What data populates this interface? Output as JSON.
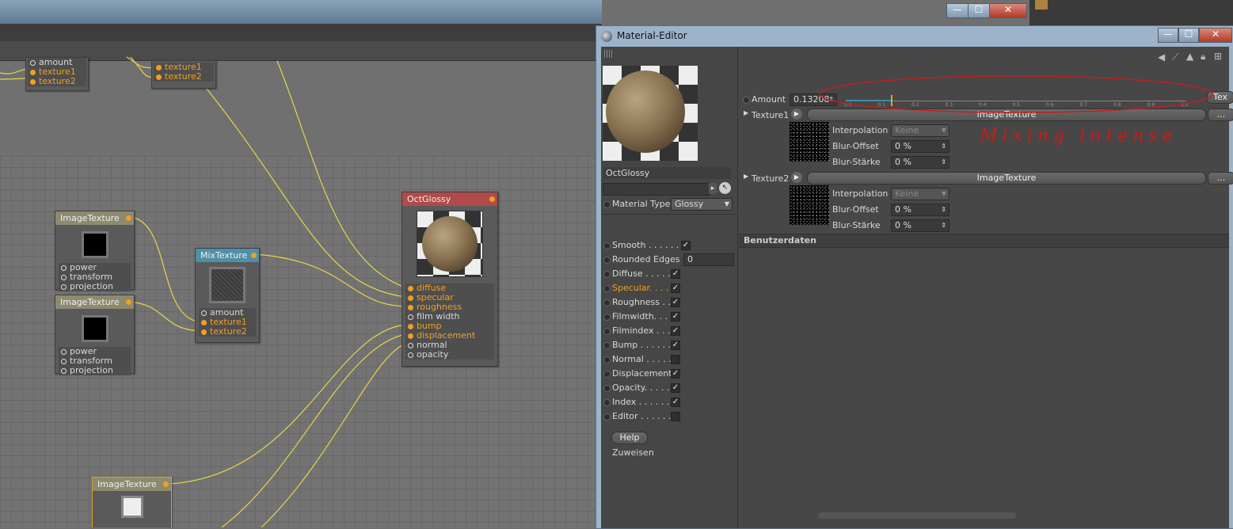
{
  "window": {
    "title": "Material-Editor",
    "min": "—",
    "max": "☐",
    "close": "✕"
  },
  "parent_window_buttons": {
    "min": "—",
    "max": "☐",
    "close": "✕"
  },
  "nodes": {
    "top_left": {
      "ports": [
        "amount",
        "texture1",
        "texture2"
      ]
    },
    "top_mid": {
      "ports": [
        "texture1",
        "texture2"
      ]
    },
    "img1": {
      "title": "ImageTexture",
      "ports": [
        "power",
        "transform",
        "projection"
      ]
    },
    "img2": {
      "title": "ImageTexture",
      "ports": [
        "power",
        "transform",
        "projection"
      ]
    },
    "mix": {
      "title": "MixTexture",
      "ports": [
        "amount",
        "texture1",
        "texture2"
      ]
    },
    "gloss": {
      "title": "OctGlossy",
      "ports": [
        "diffuse",
        "specular",
        "roughness",
        "film width",
        "bump",
        "displacement",
        "normal",
        "opacity"
      ]
    },
    "img3": {
      "title": "ImageTexture"
    }
  },
  "editor": {
    "material_name": "OctGlossy",
    "material_type_label": "Material Type",
    "material_type_value": "Glossy",
    "channels": [
      {
        "label": "Smooth . . . . . .",
        "checked": true
      },
      {
        "label": "Rounded Edges",
        "value": "0"
      },
      {
        "label": "Diffuse . . . . .",
        "checked": true
      },
      {
        "label": "Specular. . . .",
        "checked": true
      },
      {
        "label": "Roughness . .",
        "checked": true
      },
      {
        "label": "Filmwidth. . .",
        "checked": true
      },
      {
        "label": "Filmindex . . .",
        "checked": true
      },
      {
        "label": "Bump . . . . . .",
        "checked": true
      },
      {
        "label": "Normal . . . . .",
        "checked": false
      },
      {
        "label": "Displacement",
        "checked": true
      },
      {
        "label": "Opacity. . . . .",
        "checked": true
      },
      {
        "label": "Index . . . . . .",
        "checked": true
      },
      {
        "label": "Editor . . . . . .",
        "checked": false
      }
    ],
    "help_button": "Help",
    "assign_label": "Zuweisen",
    "amount_label": "Amount",
    "amount_value": "0.13208",
    "slider_value": 0.13208,
    "slider_ticks": [
      "0.0",
      "0.1",
      "0.2",
      "0.3",
      "0.4",
      "0.5",
      "0.6",
      "0.7",
      "0.8",
      "0.9",
      "1.0"
    ],
    "tex_button": "Tex",
    "texture1_label": "Texture1",
    "texture1_value": "ImageTexture",
    "texture2_label": "Texture2",
    "texture2_value": "ImageTexture",
    "more_button": "...",
    "interp_label": "Interpolation",
    "interp_value": "Keine",
    "blur_offset_label": "Blur-Offset",
    "blur_offset_value": "0 %",
    "blur_strength_label": "Blur-Stärke",
    "blur_strength_value": "0 %",
    "user_data_label": "Benutzerdaten",
    "annotation": "Mixing intense"
  },
  "colors": {
    "accent_orange": "#f0a020",
    "annotation_red": "#c0201a",
    "gloss_header": "#b14a4a",
    "mix_header": "#4f8fa7"
  }
}
